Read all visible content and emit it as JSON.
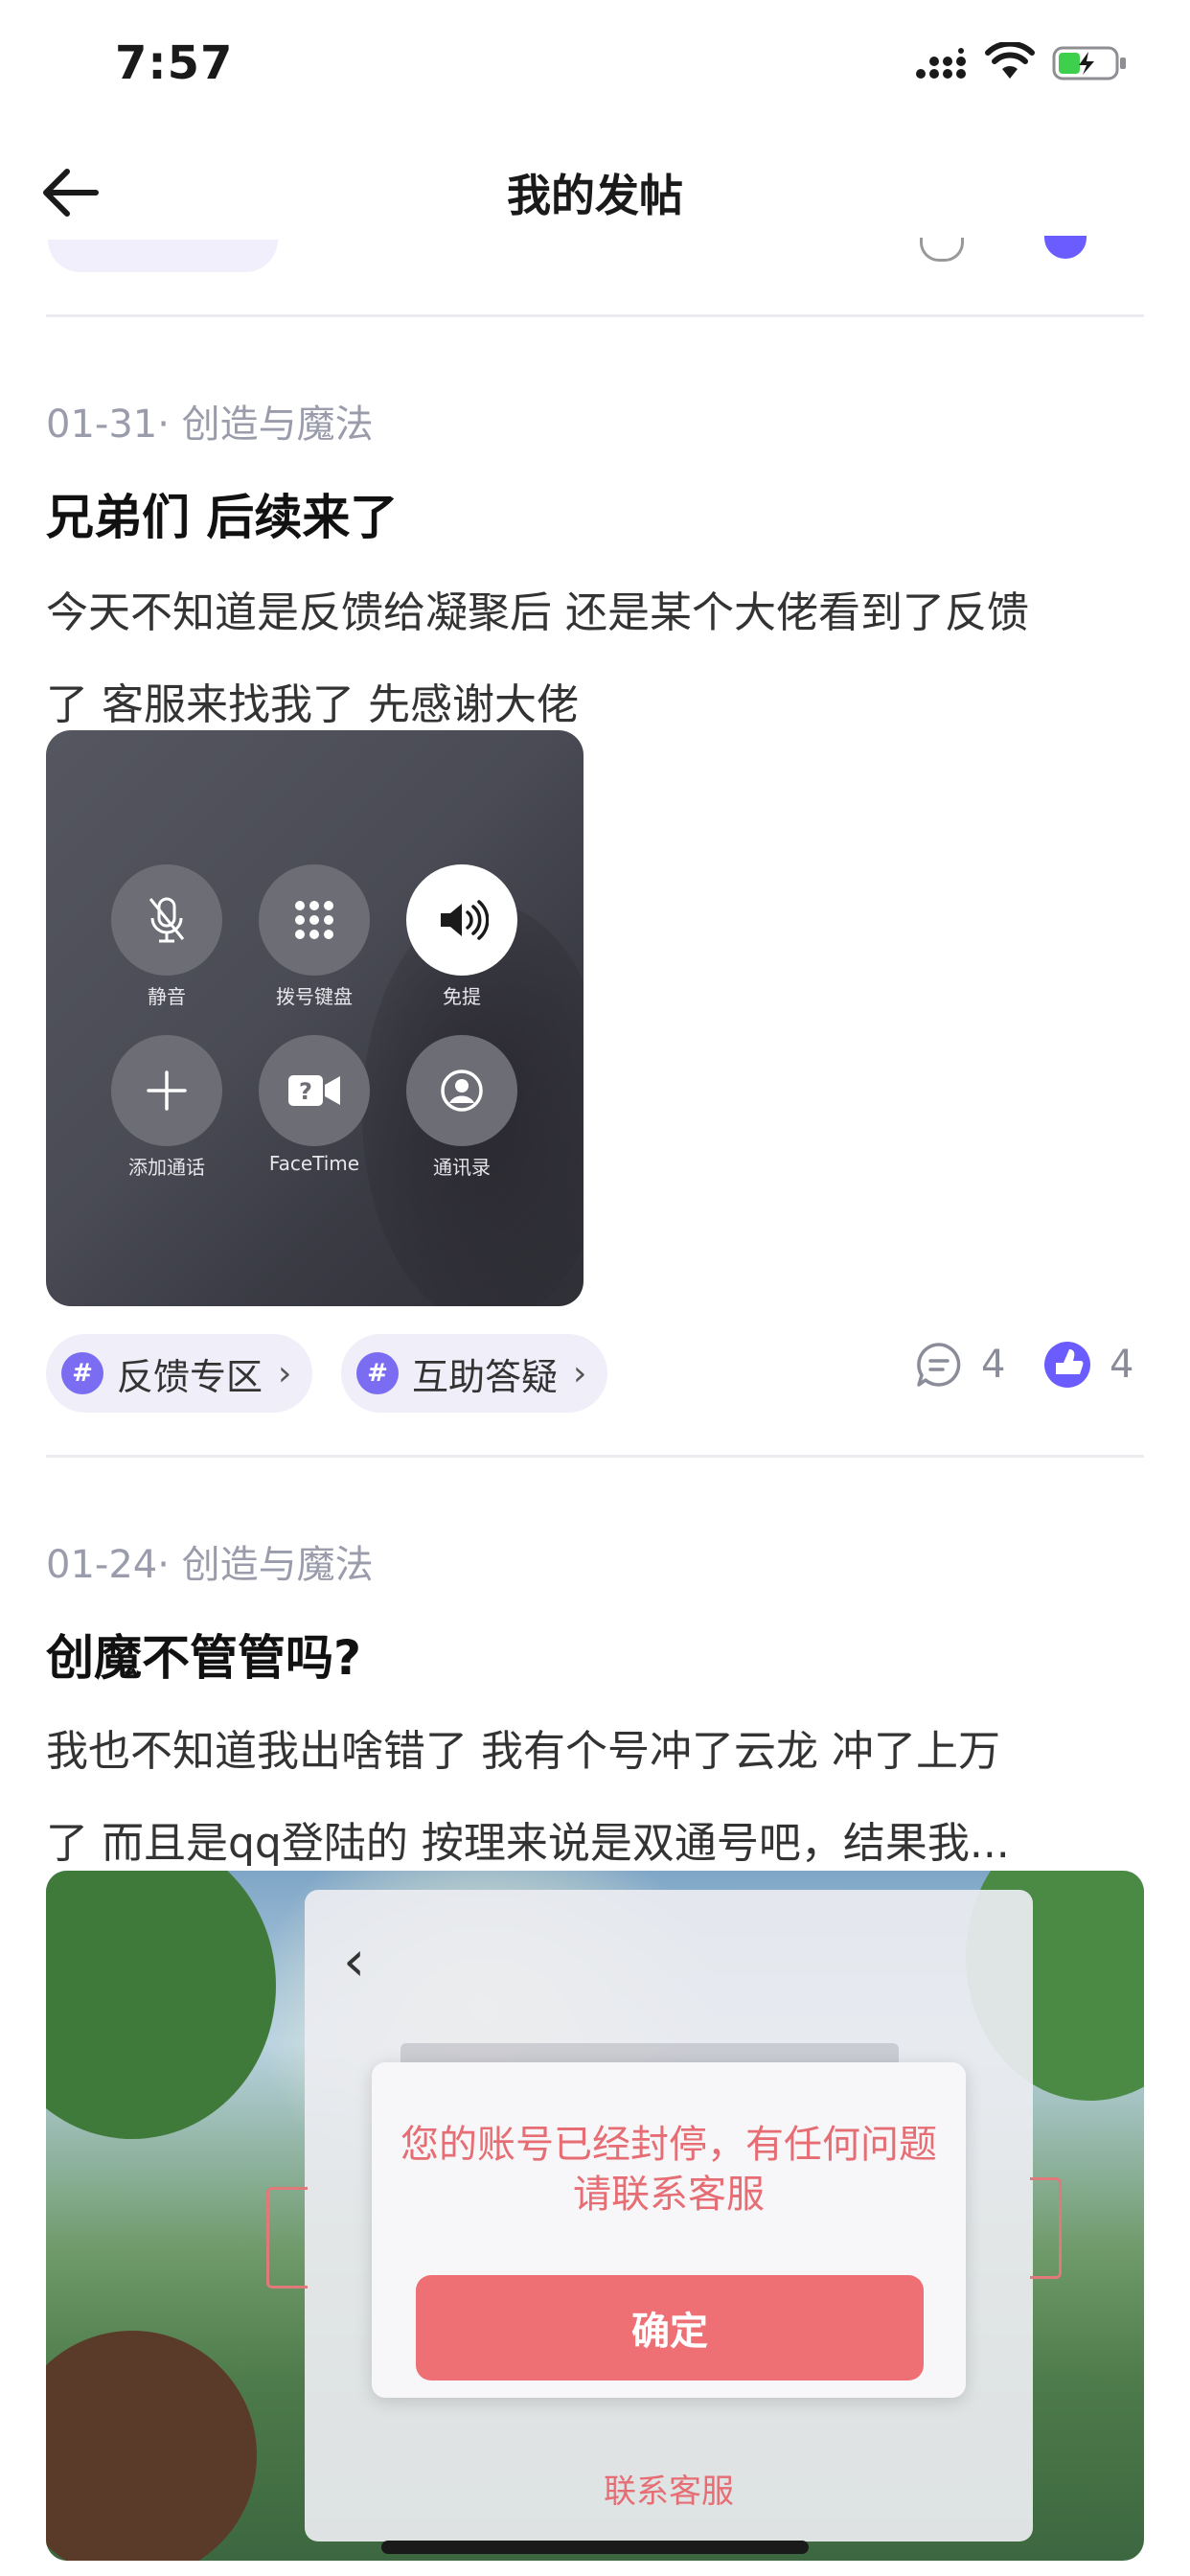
{
  "status_bar": {
    "time": "7:57"
  },
  "header": {
    "title": "我的发帖"
  },
  "posts": [
    {
      "meta": "01-31· 创造与魔法",
      "title": "兄弟们 后续来了",
      "body_line1": "今天不知道是反馈给凝聚后 还是某个大佬看到了反馈",
      "body_line2": "了 客服来找我了 先感谢大佬",
      "image": {
        "buttons": [
          {
            "label": "静音",
            "icon": "mic-off-icon"
          },
          {
            "label": "拨号键盘",
            "icon": "keypad-icon"
          },
          {
            "label": "免提",
            "icon": "speaker-icon"
          },
          {
            "label": "添加通话",
            "icon": "plus-icon"
          },
          {
            "label": "FaceTime",
            "icon": "facetime-icon"
          },
          {
            "label": "通讯录",
            "icon": "contacts-icon"
          }
        ]
      },
      "tags": [
        "反馈专区",
        "互助答疑"
      ],
      "comments": "4",
      "likes": "4"
    },
    {
      "meta": "01-24· 创造与魔法",
      "title": "创魔不管管吗?",
      "body_line1": "我也不知道我出啥错了 我有个号冲了云龙 冲了上万",
      "body_line2": "了 而且是qq登陆的 按理来说是双通号吧，结果我...",
      "image": {
        "dialog_message": "您的账号已经封停，有任何问题请联系客服",
        "dialog_button": "确定",
        "contact_link": "联系客服"
      }
    }
  ],
  "colors": {
    "accent": "#7b6df2",
    "muted": "#9a9cab",
    "alert": "#ee6f74"
  }
}
